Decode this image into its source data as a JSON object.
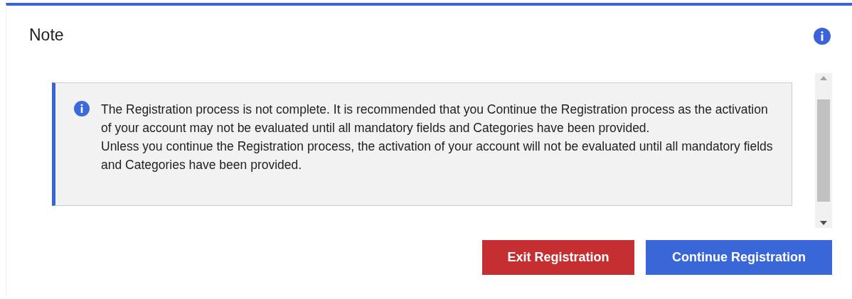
{
  "dialog": {
    "title": "Note"
  },
  "alert": {
    "paragraphs": [
      "The Registration process is not complete. It is recommended that you Continue the Registration process as the activation of your account may not be evaluated until all mandatory fields and Categories have been provided.",
      "Unless you continue the Registration process, the activation of your account will not be evaluated until all mandatory fields and Categories have been provided."
    ]
  },
  "buttons": [
    {
      "label": "Exit Registration",
      "kind": "danger"
    },
    {
      "label": "Continue Registration",
      "kind": "primary"
    }
  ]
}
